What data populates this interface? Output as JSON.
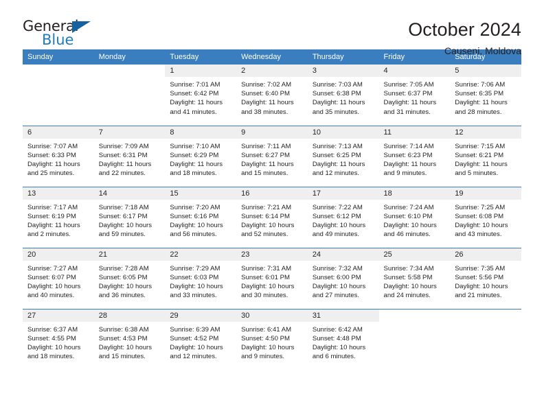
{
  "brand": {
    "name_top": "General",
    "name_bottom": "Blue",
    "triangle_color": "#15639e",
    "blue_color": "#1f7bc1"
  },
  "header": {
    "title": "October 2024",
    "subtitle": "Causeni, Moldova"
  },
  "theme": {
    "header_bg": "#3a7ebf",
    "header_text": "#ffffff",
    "daynum_bg": "#efefef",
    "grid_line": "#3a7ebf",
    "body_text": "#231f20"
  },
  "calendar": {
    "weekday_headers": [
      "Sunday",
      "Monday",
      "Tuesday",
      "Wednesday",
      "Thursday",
      "Friday",
      "Saturday"
    ],
    "labels": {
      "sunrise": "Sunrise:",
      "sunset": "Sunset:",
      "daylight": "Daylight:"
    },
    "weeks": [
      [
        {
          "day": "",
          "lines": []
        },
        {
          "day": "",
          "lines": []
        },
        {
          "day": "1",
          "lines": [
            "Sunrise: 7:01 AM",
            "Sunset: 6:42 PM",
            "Daylight: 11 hours",
            "and 41 minutes."
          ]
        },
        {
          "day": "2",
          "lines": [
            "Sunrise: 7:02 AM",
            "Sunset: 6:40 PM",
            "Daylight: 11 hours",
            "and 38 minutes."
          ]
        },
        {
          "day": "3",
          "lines": [
            "Sunrise: 7:03 AM",
            "Sunset: 6:38 PM",
            "Daylight: 11 hours",
            "and 35 minutes."
          ]
        },
        {
          "day": "4",
          "lines": [
            "Sunrise: 7:05 AM",
            "Sunset: 6:37 PM",
            "Daylight: 11 hours",
            "and 31 minutes."
          ]
        },
        {
          "day": "5",
          "lines": [
            "Sunrise: 7:06 AM",
            "Sunset: 6:35 PM",
            "Daylight: 11 hours",
            "and 28 minutes."
          ]
        }
      ],
      [
        {
          "day": "6",
          "lines": [
            "Sunrise: 7:07 AM",
            "Sunset: 6:33 PM",
            "Daylight: 11 hours",
            "and 25 minutes."
          ]
        },
        {
          "day": "7",
          "lines": [
            "Sunrise: 7:09 AM",
            "Sunset: 6:31 PM",
            "Daylight: 11 hours",
            "and 22 minutes."
          ]
        },
        {
          "day": "8",
          "lines": [
            "Sunrise: 7:10 AM",
            "Sunset: 6:29 PM",
            "Daylight: 11 hours",
            "and 18 minutes."
          ]
        },
        {
          "day": "9",
          "lines": [
            "Sunrise: 7:11 AM",
            "Sunset: 6:27 PM",
            "Daylight: 11 hours",
            "and 15 minutes."
          ]
        },
        {
          "day": "10",
          "lines": [
            "Sunrise: 7:13 AM",
            "Sunset: 6:25 PM",
            "Daylight: 11 hours",
            "and 12 minutes."
          ]
        },
        {
          "day": "11",
          "lines": [
            "Sunrise: 7:14 AM",
            "Sunset: 6:23 PM",
            "Daylight: 11 hours",
            "and 9 minutes."
          ]
        },
        {
          "day": "12",
          "lines": [
            "Sunrise: 7:15 AM",
            "Sunset: 6:21 PM",
            "Daylight: 11 hours",
            "and 5 minutes."
          ]
        }
      ],
      [
        {
          "day": "13",
          "lines": [
            "Sunrise: 7:17 AM",
            "Sunset: 6:19 PM",
            "Daylight: 11 hours",
            "and 2 minutes."
          ]
        },
        {
          "day": "14",
          "lines": [
            "Sunrise: 7:18 AM",
            "Sunset: 6:17 PM",
            "Daylight: 10 hours",
            "and 59 minutes."
          ]
        },
        {
          "day": "15",
          "lines": [
            "Sunrise: 7:20 AM",
            "Sunset: 6:16 PM",
            "Daylight: 10 hours",
            "and 56 minutes."
          ]
        },
        {
          "day": "16",
          "lines": [
            "Sunrise: 7:21 AM",
            "Sunset: 6:14 PM",
            "Daylight: 10 hours",
            "and 52 minutes."
          ]
        },
        {
          "day": "17",
          "lines": [
            "Sunrise: 7:22 AM",
            "Sunset: 6:12 PM",
            "Daylight: 10 hours",
            "and 49 minutes."
          ]
        },
        {
          "day": "18",
          "lines": [
            "Sunrise: 7:24 AM",
            "Sunset: 6:10 PM",
            "Daylight: 10 hours",
            "and 46 minutes."
          ]
        },
        {
          "day": "19",
          "lines": [
            "Sunrise: 7:25 AM",
            "Sunset: 6:08 PM",
            "Daylight: 10 hours",
            "and 43 minutes."
          ]
        }
      ],
      [
        {
          "day": "20",
          "lines": [
            "Sunrise: 7:27 AM",
            "Sunset: 6:07 PM",
            "Daylight: 10 hours",
            "and 40 minutes."
          ]
        },
        {
          "day": "21",
          "lines": [
            "Sunrise: 7:28 AM",
            "Sunset: 6:05 PM",
            "Daylight: 10 hours",
            "and 36 minutes."
          ]
        },
        {
          "day": "22",
          "lines": [
            "Sunrise: 7:29 AM",
            "Sunset: 6:03 PM",
            "Daylight: 10 hours",
            "and 33 minutes."
          ]
        },
        {
          "day": "23",
          "lines": [
            "Sunrise: 7:31 AM",
            "Sunset: 6:01 PM",
            "Daylight: 10 hours",
            "and 30 minutes."
          ]
        },
        {
          "day": "24",
          "lines": [
            "Sunrise: 7:32 AM",
            "Sunset: 6:00 PM",
            "Daylight: 10 hours",
            "and 27 minutes."
          ]
        },
        {
          "day": "25",
          "lines": [
            "Sunrise: 7:34 AM",
            "Sunset: 5:58 PM",
            "Daylight: 10 hours",
            "and 24 minutes."
          ]
        },
        {
          "day": "26",
          "lines": [
            "Sunrise: 7:35 AM",
            "Sunset: 5:56 PM",
            "Daylight: 10 hours",
            "and 21 minutes."
          ]
        }
      ],
      [
        {
          "day": "27",
          "lines": [
            "Sunrise: 6:37 AM",
            "Sunset: 4:55 PM",
            "Daylight: 10 hours",
            "and 18 minutes."
          ]
        },
        {
          "day": "28",
          "lines": [
            "Sunrise: 6:38 AM",
            "Sunset: 4:53 PM",
            "Daylight: 10 hours",
            "and 15 minutes."
          ]
        },
        {
          "day": "29",
          "lines": [
            "Sunrise: 6:39 AM",
            "Sunset: 4:52 PM",
            "Daylight: 10 hours",
            "and 12 minutes."
          ]
        },
        {
          "day": "30",
          "lines": [
            "Sunrise: 6:41 AM",
            "Sunset: 4:50 PM",
            "Daylight: 10 hours",
            "and 9 minutes."
          ]
        },
        {
          "day": "31",
          "lines": [
            "Sunrise: 6:42 AM",
            "Sunset: 4:48 PM",
            "Daylight: 10 hours",
            "and 6 minutes."
          ]
        },
        {
          "day": "",
          "lines": []
        },
        {
          "day": "",
          "lines": []
        }
      ]
    ]
  }
}
